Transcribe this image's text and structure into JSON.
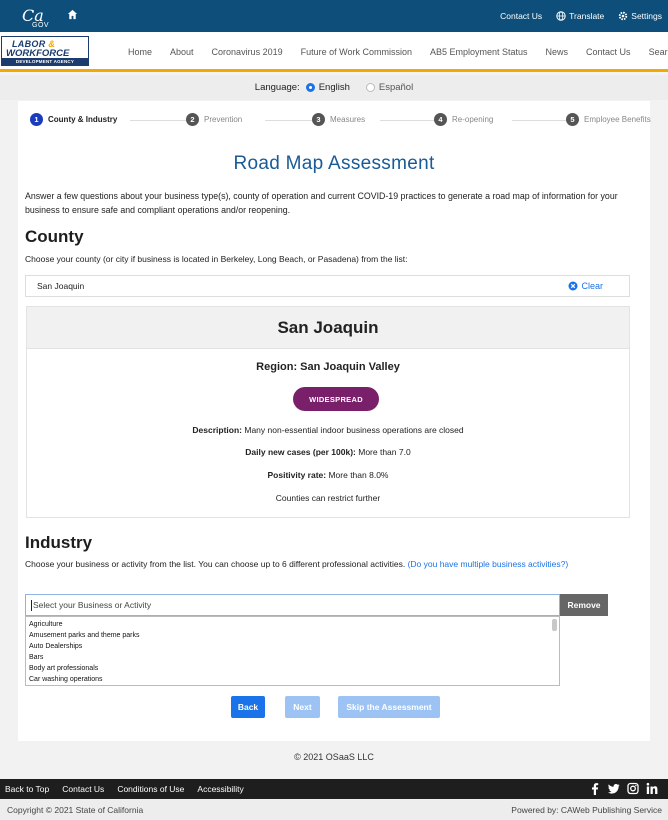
{
  "util_bar": {
    "logo_text": "Ca",
    "logo_sub": "GOV",
    "contact_label": "Contact Us",
    "translate_label": "Translate",
    "settings_label": "Settings"
  },
  "header": {
    "logo_line1": "LABOR",
    "logo_amp": "&",
    "logo_line2": "WORKFORCE",
    "logo_line3": "DEVELOPMENT AGENCY",
    "nav": [
      "Home",
      "About",
      "Coronavirus 2019",
      "Future of Work Commission",
      "AB5 Employment Status",
      "News",
      "Contact Us",
      "Search"
    ]
  },
  "language": {
    "label": "Language:",
    "options": [
      {
        "label": "English",
        "selected": true
      },
      {
        "label": "Español",
        "selected": false
      }
    ]
  },
  "steps": [
    {
      "num": "1",
      "label": "County & Industry",
      "active": true
    },
    {
      "num": "2",
      "label": "Prevention",
      "active": false
    },
    {
      "num": "3",
      "label": "Measures",
      "active": false
    },
    {
      "num": "4",
      "label": "Re-opening",
      "active": false
    },
    {
      "num": "5",
      "label": "Employee Benefits",
      "active": false
    }
  ],
  "page_title": "Road Map Assessment",
  "intro": "Answer a few questions about your business type(s), county of operation and current COVID-19 practices to generate a road map of information for your business to ensure safe and compliant operations and/or reopening.",
  "county": {
    "heading": "County",
    "instructions": "Choose your county (or city if business is located in Berkeley, Long Beach, or Pasadena) from the list:",
    "value": "San Joaquin",
    "clear_label": "Clear",
    "panel_title": "San Joaquin",
    "region": "Region: San Joaquin Valley",
    "tier_badge": "WIDESPREAD",
    "tier_color": "#7a1f6a",
    "description_label": "Description:",
    "description_value": "Many non-essential indoor business operations are closed",
    "cases_label": "Daily new cases (per 100k):",
    "cases_value": "More than 7.0",
    "positivity_label": "Positivity rate:",
    "positivity_value": "More than 8.0%",
    "note": "Counties can restrict further"
  },
  "industry": {
    "heading": "Industry",
    "instructions": "Choose your business or activity from the list. You can choose up to 6 different professional activities.",
    "link_text": "(Do you have multiple business activities?)",
    "placeholder": "Select your Business or Activity",
    "remove_label": "Remove",
    "options": [
      "Agriculture",
      "Amusement parks and theme parks",
      "Auto Dealerships",
      "Bars",
      "Body art professionals",
      "Car washing operations"
    ]
  },
  "buttons": {
    "back": "Back",
    "next": "Next",
    "skip": "Skip the Assessment"
  },
  "copyright_main": "© 2021 OSaaS LLC",
  "footer": {
    "links": [
      "Back to Top",
      "Contact Us",
      "Conditions of Use",
      "Accessibility"
    ],
    "social": [
      "facebook-icon",
      "twitter-icon",
      "instagram-icon",
      "linkedin-icon"
    ],
    "copyright": "Copyright © 2021 State of California",
    "powered_by": "Powered by: CAWeb Publishing Service"
  },
  "colors": {
    "utility_bar": "#0d4f7a",
    "accent": "#1a73e8",
    "title": "#1a5a96",
    "header_border": "#f2a900"
  }
}
